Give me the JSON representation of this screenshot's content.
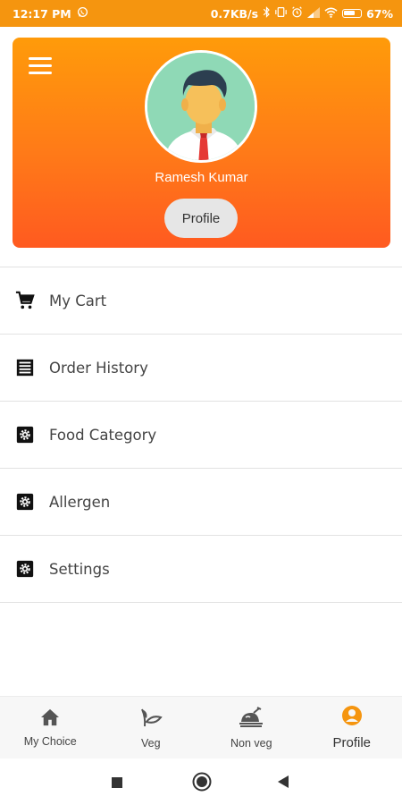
{
  "status_bar": {
    "time": "12:17 PM",
    "network_speed": "0.7KB/s",
    "battery_percent": "67%",
    "icons": [
      "whatsapp-icon",
      "bluetooth-icon",
      "vibrate-icon",
      "alarm-icon",
      "signal-icon",
      "wifi-icon",
      "battery-icon"
    ]
  },
  "header": {
    "user_name": "Ramesh Kumar",
    "profile_button_label": "Profile",
    "gradient_colors": [
      "#ff9b0a",
      "#ff5a20"
    ]
  },
  "menu": {
    "items": [
      {
        "label": "My Cart",
        "icon": "cart-icon"
      },
      {
        "label": "Order History",
        "icon": "receipt-icon"
      },
      {
        "label": "Food Category",
        "icon": "gear-icon"
      },
      {
        "label": "Allergen",
        "icon": "gear-icon"
      },
      {
        "label": "Settings",
        "icon": "gear-icon"
      }
    ]
  },
  "bottom_nav": {
    "items": [
      {
        "label": "My Choice",
        "icon": "home-icon"
      },
      {
        "label": "Veg",
        "icon": "leaf-icon"
      },
      {
        "label": "Non veg",
        "icon": "roast-chicken-icon"
      },
      {
        "label": "Profile",
        "icon": "account-circle-icon",
        "active": true
      }
    ],
    "accent_color": "#f5950f"
  },
  "system_nav": {
    "icons": [
      "recents-icon",
      "home-circle-icon",
      "back-icon"
    ]
  }
}
